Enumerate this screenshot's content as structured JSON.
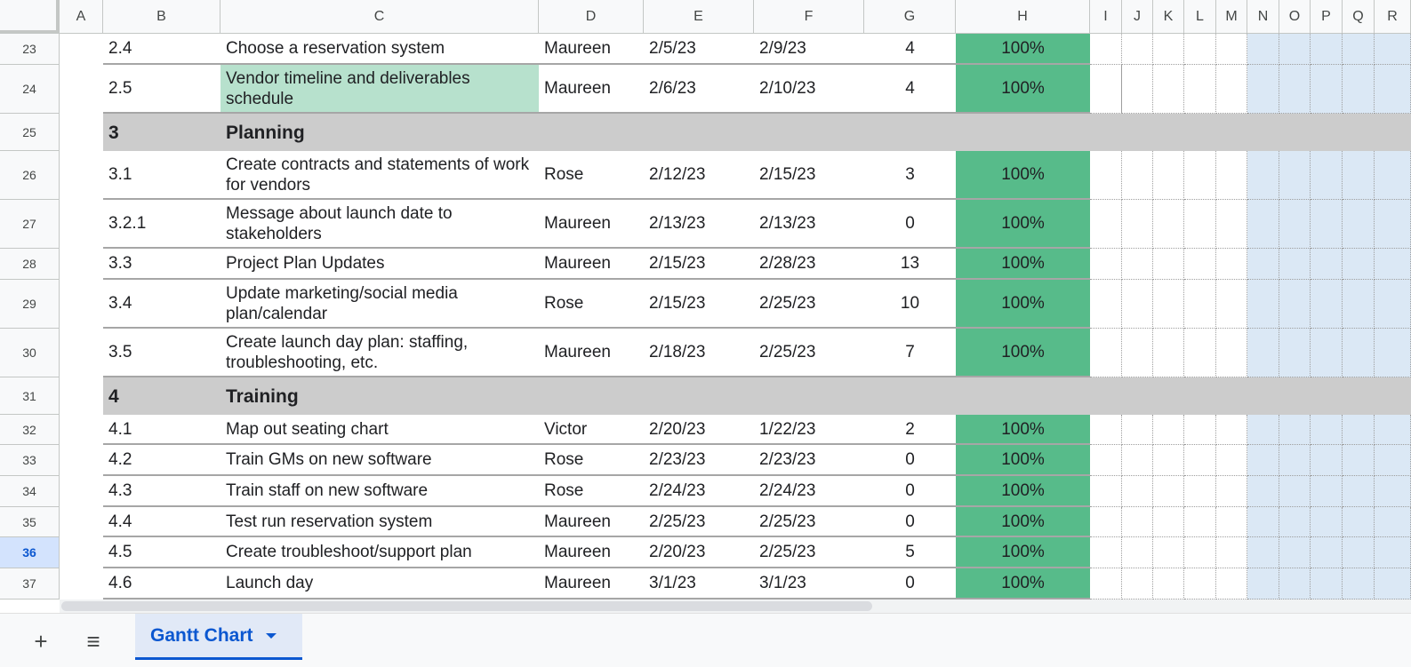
{
  "columns": [
    "A",
    "B",
    "C",
    "D",
    "E",
    "F",
    "G",
    "H",
    "I",
    "J",
    "K",
    "L",
    "M",
    "N",
    "O",
    "P",
    "Q",
    "R"
  ],
  "rows": [
    {
      "num": "23",
      "id": "2.4",
      "task": "Choose a reservation system",
      "owner": "Maureen",
      "start": "2/5/23",
      "end": "2/9/23",
      "days": "4",
      "pct": "100%"
    },
    {
      "num": "24",
      "id": "2.5",
      "task": "Vendor timeline and deliverables schedule",
      "owner": "Maureen",
      "start": "2/6/23",
      "end": "2/10/23",
      "days": "4",
      "pct": "100%",
      "highlight": true
    },
    {
      "num": "25",
      "section": true,
      "id": "3",
      "task": "Planning"
    },
    {
      "num": "26",
      "id": "3.1",
      "task": "Create contracts and statements of work for vendors",
      "owner": "Rose",
      "start": "2/12/23",
      "end": "2/15/23",
      "days": "3",
      "pct": "100%"
    },
    {
      "num": "27",
      "id": "3.2.1",
      "task": "Message about launch date to stakeholders",
      "owner": "Maureen",
      "start": "2/13/23",
      "end": "2/13/23",
      "days": "0",
      "pct": "100%"
    },
    {
      "num": "28",
      "id": "3.3",
      "task": "Project Plan Updates",
      "owner": "Maureen",
      "start": "2/15/23",
      "end": "2/28/23",
      "days": "13",
      "pct": "100%"
    },
    {
      "num": "29",
      "id": "3.4",
      "task": "Update marketing/social media plan/calendar",
      "owner": "Rose",
      "start": "2/15/23",
      "end": "2/25/23",
      "days": "10",
      "pct": "100%"
    },
    {
      "num": "30",
      "id": "3.5",
      "task": "Create launch day plan: staffing, troubleshooting, etc.",
      "owner": "Maureen",
      "start": "2/18/23",
      "end": "2/25/23",
      "days": "7",
      "pct": "100%"
    },
    {
      "num": "31",
      "section": true,
      "id": "4",
      "task": "Training"
    },
    {
      "num": "32",
      "id": "4.1",
      "task": "Map out seating chart",
      "owner": "Victor",
      "start": "2/20/23",
      "end": "1/22/23",
      "days": "2",
      "pct": "100%"
    },
    {
      "num": "33",
      "id": "4.2",
      "task": "Train GMs on new software",
      "owner": "Rose",
      "start": "2/23/23",
      "end": "2/23/23",
      "days": "0",
      "pct": "100%"
    },
    {
      "num": "34",
      "id": "4.3",
      "task": "Train staff on new software",
      "owner": "Rose",
      "start": "2/24/23",
      "end": "2/24/23",
      "days": "0",
      "pct": "100%"
    },
    {
      "num": "35",
      "id": "4.4",
      "task": "Test run reservation system",
      "owner": "Maureen",
      "start": "2/25/23",
      "end": "2/25/23",
      "days": "0",
      "pct": "100%"
    },
    {
      "num": "36",
      "id": "4.5",
      "task": "Create troubleshoot/support plan",
      "owner": "Maureen",
      "start": "2/20/23",
      "end": "2/25/23",
      "days": "5",
      "pct": "100%",
      "selected": true
    },
    {
      "num": "37",
      "id": "4.6",
      "task": "Launch day",
      "owner": "Maureen",
      "start": "3/1/23",
      "end": "3/1/23",
      "days": "0",
      "pct": "100%"
    }
  ],
  "sheetbar": {
    "add_icon": "plus-icon",
    "add_symbol": "+",
    "menu_icon": "hamburger-menu-icon",
    "menu_symbol": "≡",
    "tab_label": "Gantt Chart",
    "tab_dropdown_icon": "caret-down-icon"
  },
  "colors": {
    "complete": "#57bb8a",
    "highlight": "#b7e1cd",
    "section": "#cccccc",
    "gantt_week": "#dbe8f5",
    "accent": "#0b57d0"
  }
}
